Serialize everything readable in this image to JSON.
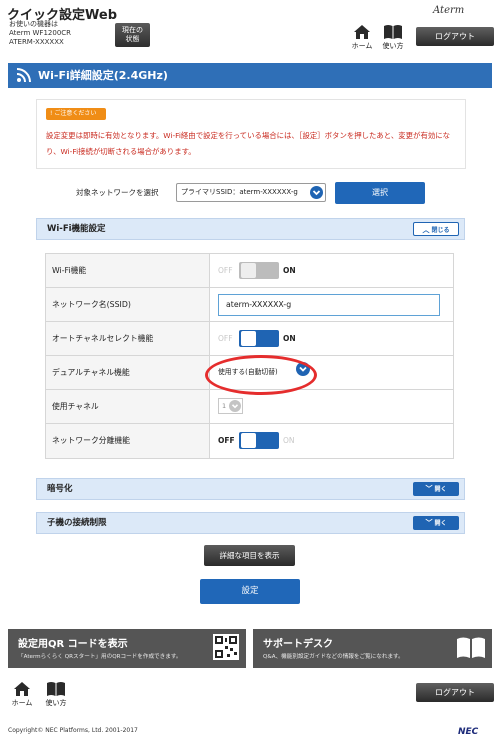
{
  "header": {
    "app_title": "クイック設定Web",
    "device_line1": "お使いの機器は",
    "device_line2": "Aterm WF1200CR",
    "device_line3": "ATERM-XXXXXX",
    "status_button_line1": "現在の",
    "status_button_line2": "状態",
    "brand": "Aterm",
    "home_label": "ホーム",
    "help_label": "使い方",
    "logout_label": "ログアウト"
  },
  "page": {
    "title": "Wi-Fi詳細設定(2.4GHz)"
  },
  "notice": {
    "badge": "ご注意ください",
    "text": "設定変更は即時に有効となります。Wi-Fi経由で設定を行っている場合には、［設定］ボタンを押したあと、変更が有効になり、Wi-Fi接続が切断される場合があります。"
  },
  "network_selector": {
    "label": "対象ネットワークを選択",
    "selected": "プライマリSSID：aterm-XXXXXX-g",
    "button": "選択"
  },
  "wifi_section": {
    "title": "Wi-Fi機能設定",
    "toggle_button": "閉じる",
    "rows": [
      {
        "label": "Wi-Fi機能",
        "type": "toggle",
        "off": "OFF",
        "on": "ON",
        "state_on": true,
        "disabled": true
      },
      {
        "label": "ネットワーク名(SSID)",
        "type": "input",
        "value": "aterm-XXXXXX-g"
      },
      {
        "label": "オートチャネルセレクト機能",
        "type": "toggle",
        "off": "OFF",
        "on": "ON",
        "state_on": true,
        "disabled": false
      },
      {
        "label": "デュアルチャネル機能",
        "type": "select",
        "value": "使用する(自動切替)"
      },
      {
        "label": "使用チャネル",
        "type": "select-disabled",
        "value": "1"
      },
      {
        "label": "ネットワーク分離機能",
        "type": "toggle",
        "off": "OFF",
        "on": "ON",
        "state_on": false,
        "disabled": false
      }
    ]
  },
  "encryption_section": {
    "title": "暗号化",
    "toggle_button": "開く"
  },
  "client_limit_section": {
    "title": "子機の接続制限",
    "toggle_button": "開く"
  },
  "actions": {
    "advanced_button": "詳細な項目を表示",
    "apply_button": "設定"
  },
  "promos": [
    {
      "title": "設定用QR コードを表示",
      "desc": "「Atermらくらく QRスタート」用のQRコードを作成できます。",
      "icon": "qr-code-icon"
    },
    {
      "title": "サポートデスク",
      "desc": "Q&A、機能別設定ガイドなどの情報をご覧になれます。",
      "icon": "book-icon"
    }
  ],
  "footer": {
    "home_label": "ホーム",
    "help_label": "使い方",
    "logout_label": "ログアウト",
    "copyright": "Copyright© NEC Platforms, Ltd. 2001-2017",
    "logo": "NEC"
  },
  "colors": {
    "primary_blue": "#2067b8",
    "notice_red": "#c92a1f",
    "notice_orange": "#f08d16",
    "highlight_oval": "#e52d2d"
  }
}
